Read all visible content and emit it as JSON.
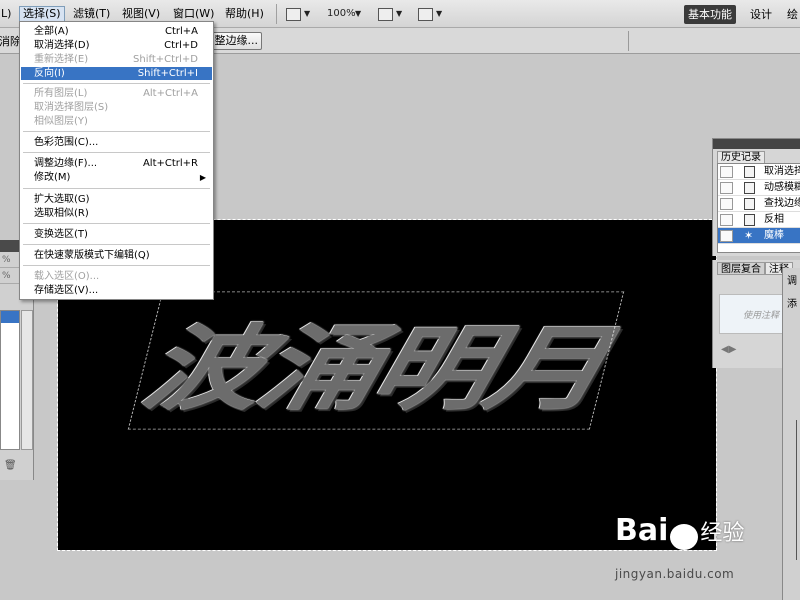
{
  "menubar": {
    "items": [
      "L)",
      "选择(S)",
      "滤镜(T)",
      "视图(V)",
      "窗口(W)",
      "帮助(H)"
    ],
    "zoom": "100%",
    "workspaces": {
      "active": "基本功能",
      "items": [
        "设计",
        "绘"
      ]
    }
  },
  "options": {
    "left_label": "消除锯",
    "refine_button": "整边缘..."
  },
  "select_menu": {
    "items": [
      {
        "label": "全部(A)",
        "shortcut": "Ctrl+A"
      },
      {
        "label": "取消选择(D)",
        "shortcut": "Ctrl+D"
      },
      {
        "label": "重新选择(E)",
        "shortcut": "Shift+Ctrl+D"
      },
      {
        "label": "反向(I)",
        "shortcut": "Shift+Ctrl+I"
      },
      {
        "label": "所有图层(L)",
        "shortcut": "Alt+Ctrl+A"
      },
      {
        "label": "取消选择图层(S)",
        "shortcut": ""
      },
      {
        "label": "相似图层(Y)",
        "shortcut": ""
      },
      {
        "label": "色彩范围(C)...",
        "shortcut": ""
      },
      {
        "label": "调整边缘(F)...",
        "shortcut": "Alt+Ctrl+R"
      },
      {
        "label": "修改(M)",
        "shortcut": ""
      },
      {
        "label": "扩大选取(G)",
        "shortcut": ""
      },
      {
        "label": "选取相似(R)",
        "shortcut": ""
      },
      {
        "label": "变换选区(T)",
        "shortcut": ""
      },
      {
        "label": "在快速蒙版模式下编辑(Q)",
        "shortcut": ""
      },
      {
        "label": "载入选区(O)...",
        "shortcut": ""
      },
      {
        "label": "存储选区(V)...",
        "shortcut": ""
      }
    ]
  },
  "canvas": {
    "text": "波涌明月"
  },
  "history": {
    "tab": "历史记录",
    "items": [
      "取消选择",
      "动感模糊",
      "查找边缘",
      "反相",
      "魔棒"
    ]
  },
  "layer_comps": {
    "tabs": [
      "图层复合",
      "注释"
    ],
    "hint": "使用注释"
  },
  "adjust": {
    "title": "调",
    "sub": "添"
  },
  "watermark": {
    "logo_left": "Bai",
    "logo_right": "经验",
    "url": "jingyan.baidu.com"
  }
}
